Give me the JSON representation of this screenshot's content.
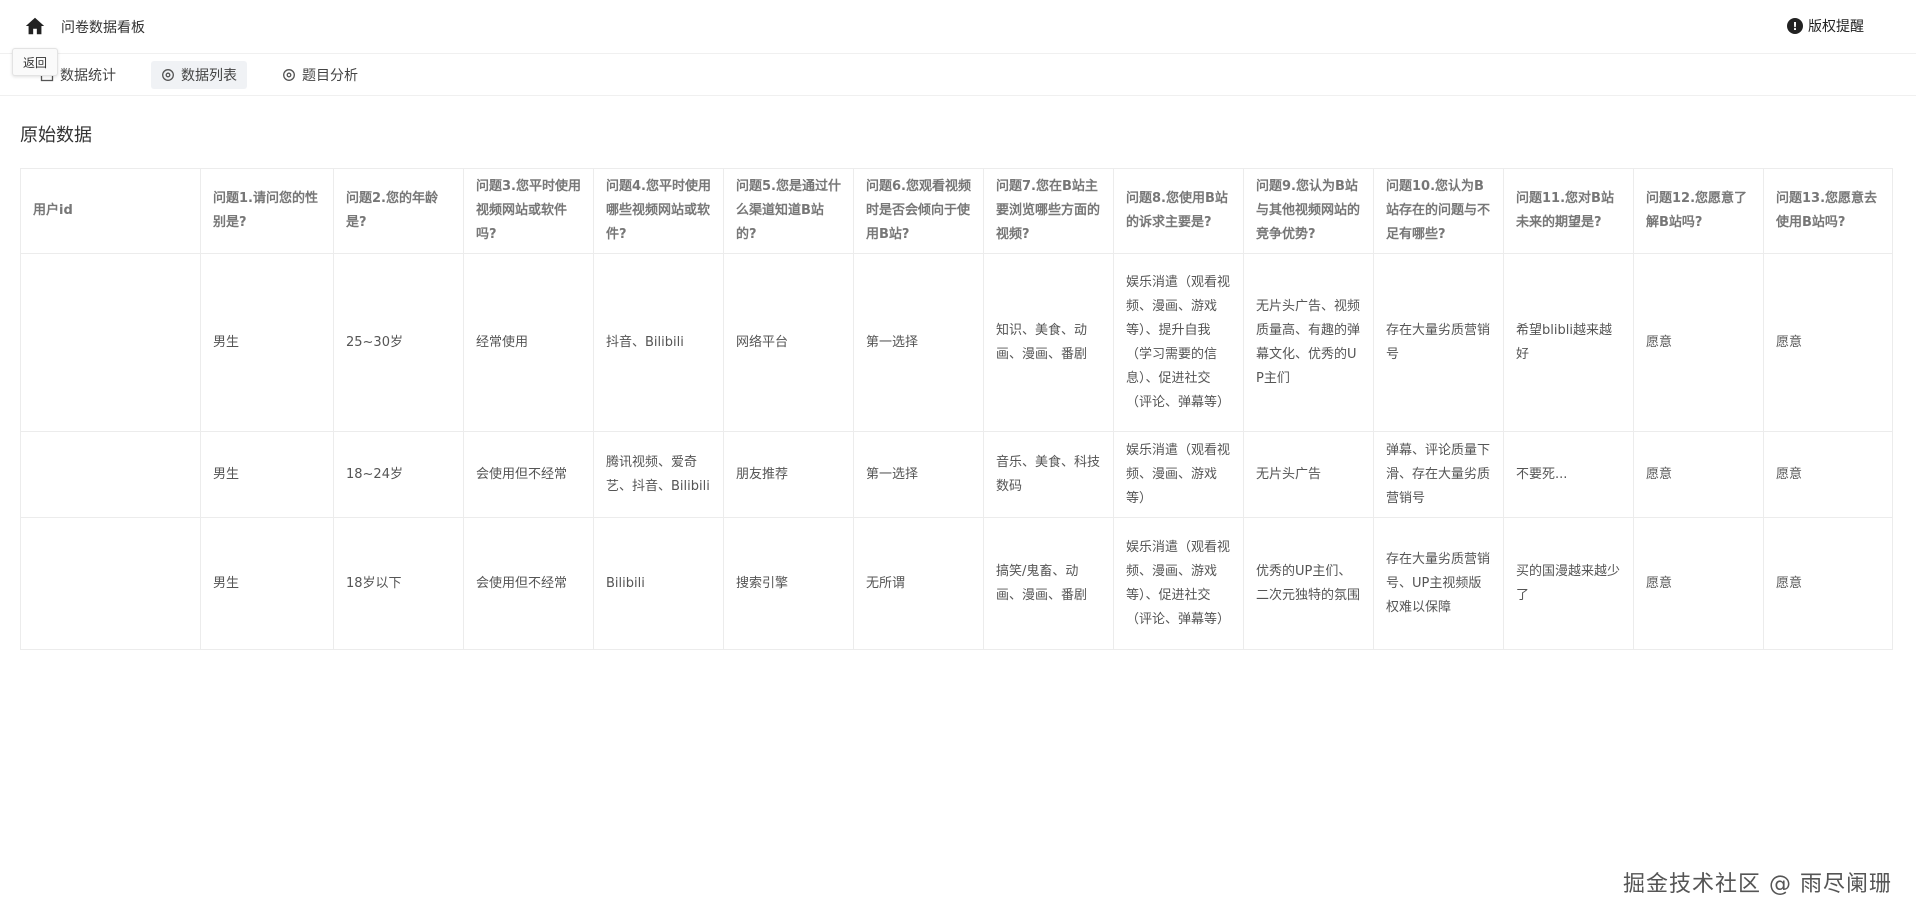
{
  "header": {
    "title": "问卷数据看板",
    "notice_label": "版权提醒"
  },
  "tabs": [
    {
      "label": "数据统计"
    },
    {
      "label": "数据列表"
    },
    {
      "label": "题目分析"
    }
  ],
  "back_label": "返回",
  "section_title": "原始数据",
  "table": {
    "columns": [
      "用户id",
      "问题1.请问您的性别是?",
      "问题2.您的年龄是?",
      "问题3.您平时使用视频网站或软件吗?",
      "问题4.您平时使用哪些视频网站或软件?",
      "问题5.您是通过什么渠道知道B站的?",
      "问题6.您观看视频时是否会倾向于使用B站?",
      "问题7.您在B站主要浏览哪些方面的视频?",
      "问题8.您使用B站的诉求主要是?",
      "问题9.您认为B站与其他视频网站的竞争优势?",
      "问题10.您认为B站存在的问题与不足有哪些?",
      "问题11.您对B站未来的期望是?",
      "问题12.您愿意了解B站吗?",
      "问题13.您愿意去使用B站吗?"
    ],
    "rows": [
      [
        "",
        "男生",
        "25~30岁",
        "经常使用",
        "抖音、Bilibili",
        "网络平台",
        "第一选择",
        "知识、美食、动画、漫画、番剧",
        "娱乐消遣（观看视频、漫画、游戏等）、提升自我（学习需要的信息）、促进社交（评论、弹幕等）",
        "无片头广告、视频质量高、有趣的弹幕文化、优秀的UP主们",
        "存在大量劣质营销号",
        "希望blibli越来越好",
        "愿意",
        "愿意"
      ],
      [
        "",
        "男生",
        "18~24岁",
        "会使用但不经常",
        "腾讯视频、爱奇艺、抖音、Bilibili",
        "朋友推荐",
        "第一选择",
        "音乐、美食、科技数码",
        "娱乐消遣（观看视频、漫画、游戏等）",
        "无片头广告",
        "弹幕、评论质量下滑、存在大量劣质营销号",
        "不要死...",
        "愿意",
        "愿意"
      ],
      [
        "",
        "男生",
        "18岁以下",
        "会使用但不经常",
        "Bilibili",
        "搜索引擎",
        "无所谓",
        "搞笑/鬼畜、动画、漫画、番剧",
        "娱乐消遣（观看视频、漫画、游戏等）、促进社交（评论、弹幕等）",
        "优秀的UP主们、二次元独特的氛围",
        "存在大量劣质营销号、UP主视频版权难以保障",
        "买的国漫越来越少了",
        "愿意",
        "愿意"
      ]
    ]
  },
  "watermark": "掘金技术社区 @ 雨尽阑珊"
}
